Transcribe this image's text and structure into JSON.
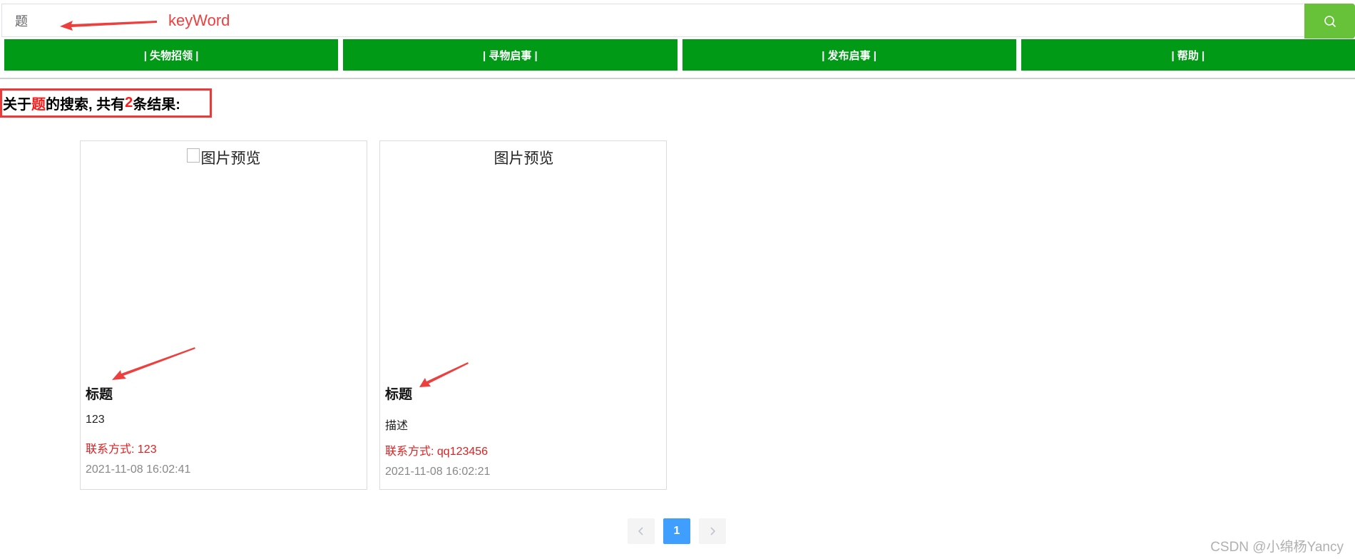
{
  "search": {
    "value": "题",
    "annotation": "keyWord"
  },
  "nav": {
    "items": [
      {
        "label": "| 失物招领 |"
      },
      {
        "label": "| 寻物启事 |"
      },
      {
        "label": "| 发布启事 |"
      },
      {
        "label": "| 帮助 |"
      }
    ]
  },
  "results": {
    "prefix": "关于",
    "keyword": "题",
    "middle": "的搜索, 共有",
    "count": "2",
    "suffix": "条结果:"
  },
  "cards": [
    {
      "image_alt": "图片预览",
      "title": "标题",
      "description": "123",
      "contact": "联系方式: 123",
      "time": "2021-11-08 16:02:41"
    },
    {
      "image_alt": "图片预览",
      "title": "标题",
      "description": "描述",
      "contact": "联系方式: qq123456",
      "time": "2021-11-08 16:02:21"
    }
  ],
  "pagination": {
    "current": "1"
  },
  "watermark": "CSDN @小绵杨Yancy",
  "colors": {
    "nav_bg": "#009a17",
    "search_button": "#67c23a",
    "highlight": "#ff1a1a",
    "annotation": "#ee3f3f",
    "pager_active": "#409eff"
  }
}
